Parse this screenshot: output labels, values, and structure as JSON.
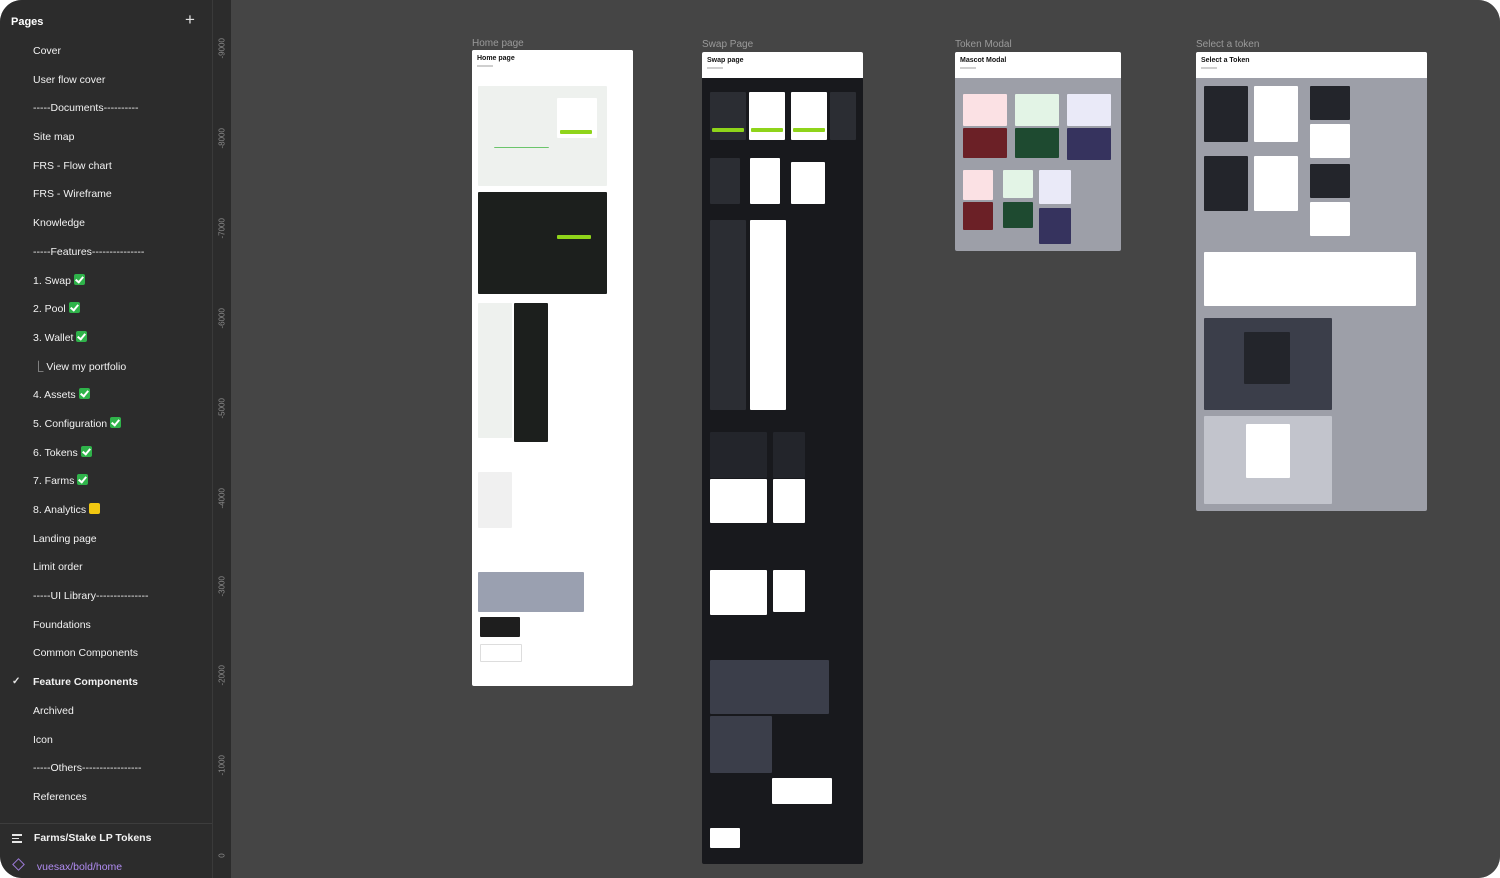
{
  "sidebar": {
    "header": "Pages",
    "add_icon": "plus-icon",
    "pages": [
      {
        "label": "Cover"
      },
      {
        "label": "User flow cover"
      },
      {
        "label": "-----Documents----------"
      },
      {
        "label": "Site map"
      },
      {
        "label": "FRS - Flow chart"
      },
      {
        "label": "FRS - Wireframe"
      },
      {
        "label": "Knowledge"
      },
      {
        "label": "-----Features---------------"
      },
      {
        "label": "1. Swap",
        "badge": "check-mark-icon"
      },
      {
        "label": "2. Pool",
        "badge": "check-mark-icon"
      },
      {
        "label": "3. Wallet",
        "badge": "check-mark-icon"
      },
      {
        "label": "⎿ View my portfolio"
      },
      {
        "label": "4. Assets",
        "badge": "check-mark-icon"
      },
      {
        "label": "5. Configuration",
        "badge": "check-mark-icon"
      },
      {
        "label": "6. Tokens",
        "badge": "check-mark-icon"
      },
      {
        "label": "7. Farms",
        "badge": "check-mark-icon"
      },
      {
        "label": "8. Analytics",
        "badge": "yellow-square-icon"
      },
      {
        "label": "Landing page"
      },
      {
        "label": "Limit order"
      },
      {
        "label": "-----UI Library---------------"
      },
      {
        "label": "Foundations"
      },
      {
        "label": "Common Components"
      },
      {
        "label": "Feature Components",
        "selected": true
      },
      {
        "label": "Archived"
      },
      {
        "label": "Icon"
      },
      {
        "label": "-----Others-----------------"
      },
      {
        "label": "References"
      }
    ],
    "layer": "Farms/Stake LP Tokens",
    "component": "vuesax/bold/home"
  },
  "ruler": {
    "ticks": [
      "-9000",
      "-8000",
      "-7000",
      "-6000",
      "-5000",
      "-4000",
      "-3000",
      "-2000",
      "-1000",
      "0"
    ]
  },
  "canvas": {
    "frames": [
      {
        "label": "Home page",
        "title": "Home page"
      },
      {
        "label": "Swap Page",
        "title": "Swap page"
      },
      {
        "label": "Token Modal",
        "title": "Mascot Modal"
      },
      {
        "label": "Select a token",
        "title": "Select a Token"
      }
    ]
  },
  "colors": {
    "canvas": "#454545",
    "sidebar": "#2c2c2c",
    "accent_green": "#8fd41a",
    "component_purple": "#b18cf2",
    "dark_frame": "#18191d",
    "modal_bg": "#9d9fa8"
  }
}
